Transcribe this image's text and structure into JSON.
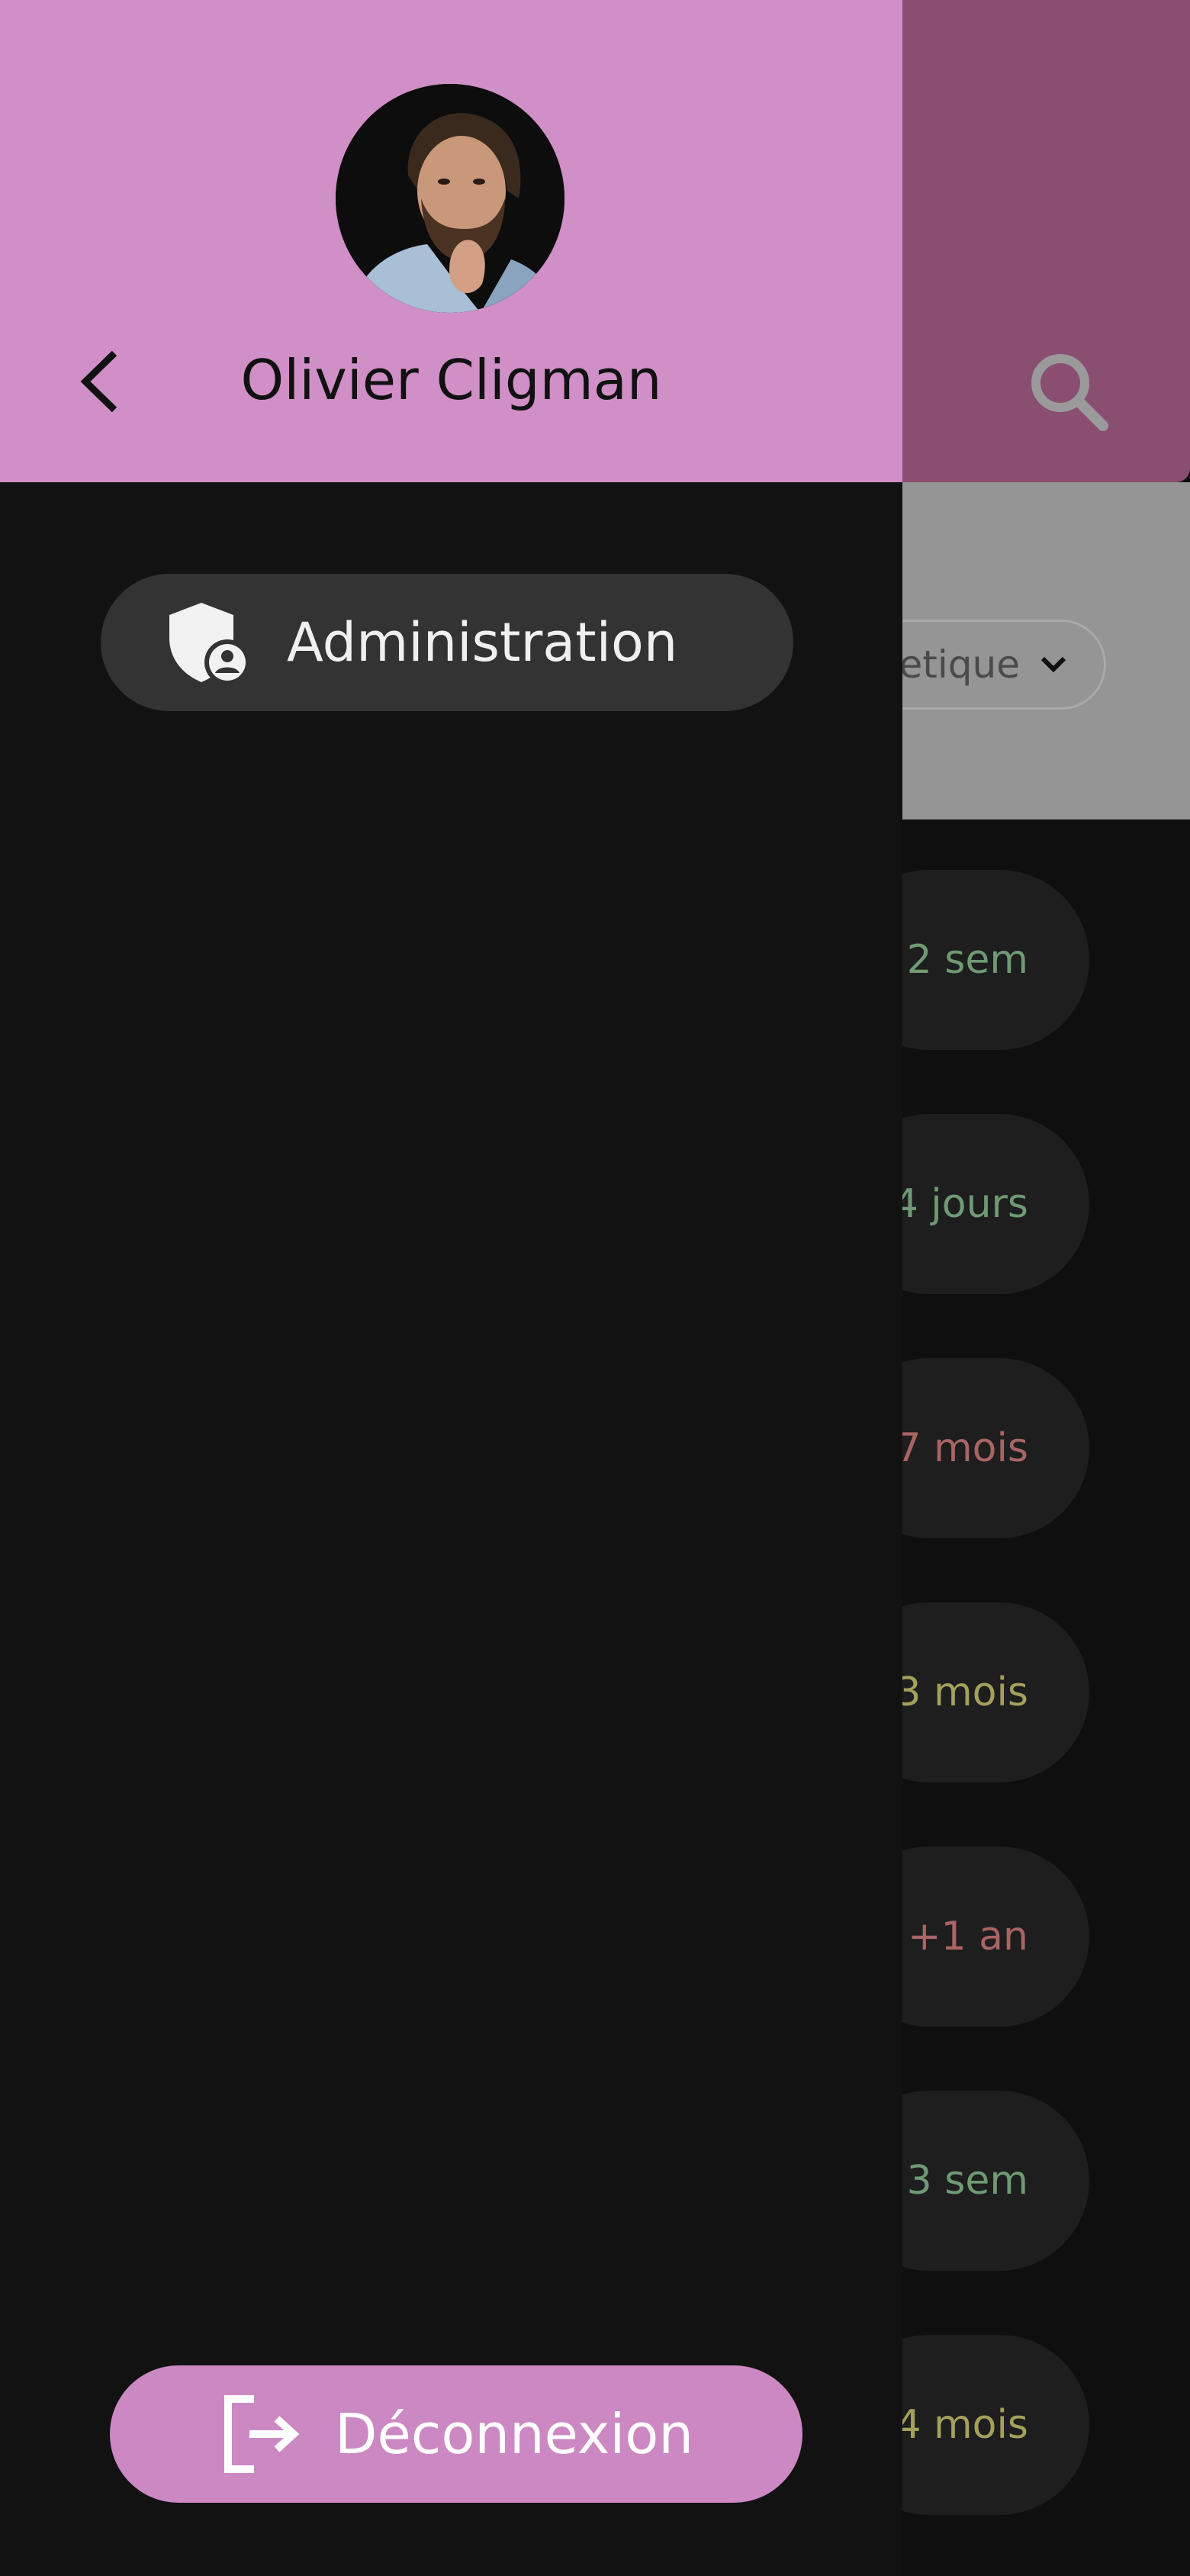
{
  "drawer": {
    "user_name": "Olivier Cligman",
    "avatar_icon": "user-portrait",
    "back_icon": "chevron-left-icon",
    "menu_items": [
      {
        "label": "Administration",
        "icon": "admin-shield-icon"
      }
    ],
    "logout": {
      "label": "Déconnexion",
      "icon": "logout-icon"
    },
    "colors": {
      "header": "#d08fc7",
      "logout_bg": "#cc88c3",
      "item_bg": "#333333",
      "background": "#121212"
    }
  },
  "background_screen": {
    "sort_label": "etique",
    "list_durations": [
      {
        "text": "2 sem",
        "color": "#6f9a74"
      },
      {
        "text": "4 jours",
        "color": "#6f9a74"
      },
      {
        "text": "7 mois",
        "color": "#a96464"
      },
      {
        "text": "3 mois",
        "color": "#a3a15a"
      },
      {
        "text": "+1 an",
        "color": "#a96464"
      },
      {
        "text": "3 sem",
        "color": "#6f9a74"
      },
      {
        "text": "4 mois",
        "color": "#a3a15a"
      }
    ]
  }
}
